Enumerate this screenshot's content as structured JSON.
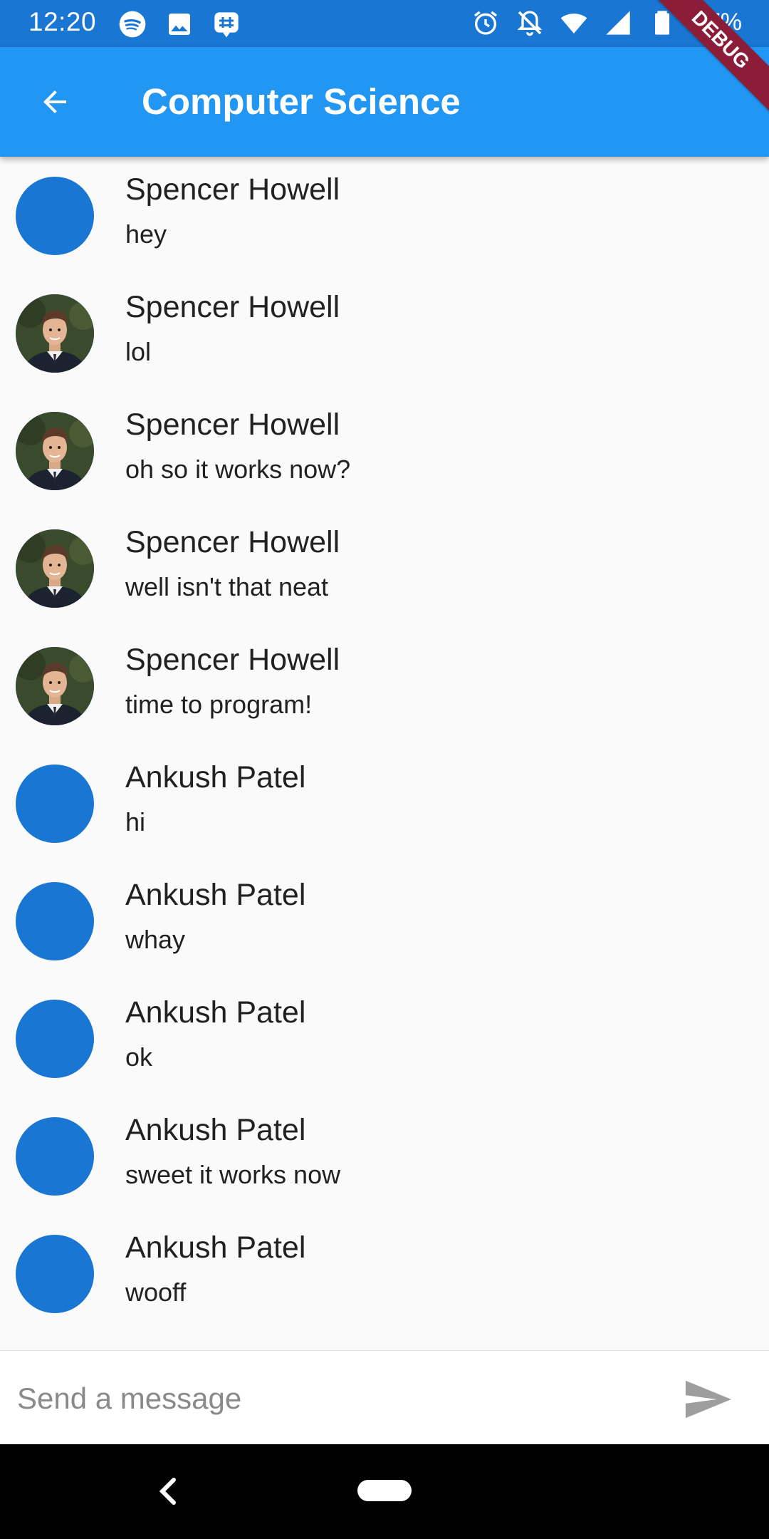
{
  "status_bar": {
    "time": "12:20",
    "battery_text": "77%",
    "left_icons": [
      "spotify-icon",
      "image-icon",
      "slack-icon"
    ],
    "right_icons": [
      "alarm-icon",
      "notifications-off-icon",
      "wifi-icon",
      "signal-icon",
      "battery-icon"
    ]
  },
  "app_bar": {
    "title": "Computer Science",
    "back_icon": "arrow-back-icon",
    "background": "#2196f3"
  },
  "debug_banner": "DEBUG",
  "messages": [
    {
      "name": "Spencer Howell",
      "text": "hey",
      "avatar": "default"
    },
    {
      "name": "Spencer Howell",
      "text": "lol",
      "avatar": "photo"
    },
    {
      "name": "Spencer Howell",
      "text": "oh so it works now?",
      "avatar": "photo"
    },
    {
      "name": "Spencer Howell",
      "text": "well isn't that neat",
      "avatar": "photo"
    },
    {
      "name": "Spencer Howell",
      "text": "time to program!",
      "avatar": "photo"
    },
    {
      "name": "Ankush Patel",
      "text": "hi",
      "avatar": "default"
    },
    {
      "name": "Ankush Patel",
      "text": "whay",
      "avatar": "default"
    },
    {
      "name": "Ankush Patel",
      "text": "ok",
      "avatar": "default"
    },
    {
      "name": "Ankush Patel",
      "text": "sweet it works now",
      "avatar": "default"
    },
    {
      "name": "Ankush Patel",
      "text": "wooff",
      "avatar": "default"
    }
  ],
  "composer": {
    "placeholder": "Send a message",
    "value": "",
    "send_icon": "send-icon"
  },
  "colors": {
    "avatar_default": "#1976d2",
    "status_bar": "#1976d2",
    "banner": "#8b1d39"
  }
}
